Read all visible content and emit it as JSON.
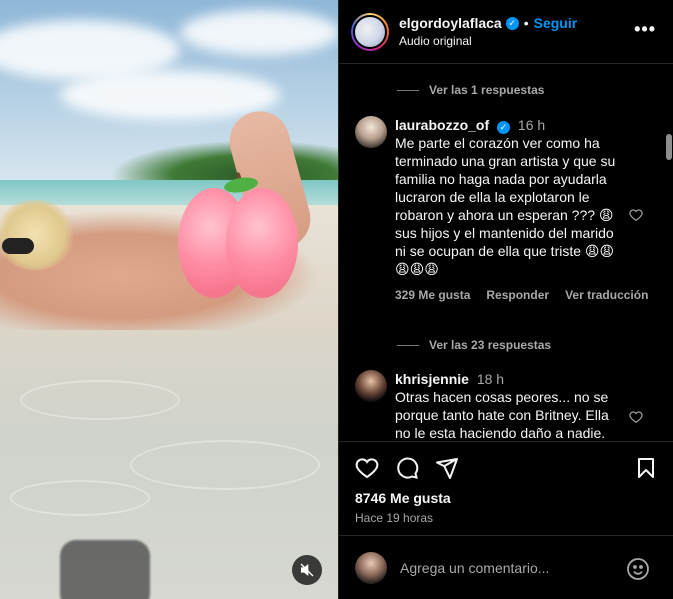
{
  "header": {
    "username": "elgordoylaflaca",
    "separator": "•",
    "follow_label": "Seguir",
    "audio_label": "Audio original",
    "more_label": "•••"
  },
  "comments": {
    "replies_top": "Ver las 1 respuestas",
    "replies_mid": "Ver las 23 respuestas",
    "items": [
      {
        "username": "laurabozzo_of",
        "time": "16 h",
        "text": "Me parte el corazón ver como ha terminado una gran artista y que su familia no haga nada por ayudarla lucraron de ella la explotaron le robaron y ahora un esperan ??? 😩sus hijos y el mantenido del marido ni se ocupan de ella que triste 😩😩😩😩😩",
        "likes": "329 Me gusta",
        "reply": "Responder",
        "translate": "Ver traducción"
      },
      {
        "username": "khrisjennie",
        "time": "18 h",
        "text": "Otras hacen cosas peores... no se porque tanto hate con Britney. Ella no le esta haciendo daño a nadie."
      }
    ]
  },
  "post": {
    "likes": "8746 Me gusta",
    "time_ago": "Hace 19 horas"
  },
  "compose": {
    "placeholder": "Agrega un comentario..."
  },
  "icons": {
    "like": "heart-icon",
    "comment": "comment-icon",
    "share": "share-icon",
    "save": "bookmark-icon",
    "mute": "muted-speaker-icon",
    "emoji": "emoji-icon"
  },
  "colors": {
    "accent": "#0095f6",
    "background": "#000000",
    "secondary_text": "#a8a8a8"
  }
}
